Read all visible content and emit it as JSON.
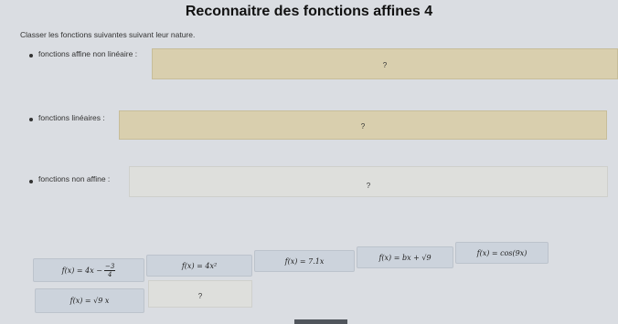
{
  "title": "Reconnaitre des fonctions affines 4",
  "instruction": "Classer les fonctions suivantes suivant leur nature.",
  "categories": [
    {
      "label": "fonctions affine non linéaire :",
      "drop_placeholder": "?"
    },
    {
      "label": "fonctions linéaires :",
      "drop_placeholder": "?"
    },
    {
      "label": "fonctions non affine :",
      "drop_placeholder": "?"
    }
  ],
  "cards": [
    {
      "prefix": "f(x) = 4x −",
      "frac_num": "−3",
      "frac_den": "4"
    },
    {
      "text": "f(x) = 4x²"
    },
    {
      "text": "f(x) = 7.1x"
    },
    {
      "text": "f(x) = bx + √9"
    },
    {
      "text": "f(x) = cos(9x)"
    },
    {
      "text": "f(x) = √9 x"
    }
  ],
  "pool_placeholder": "?"
}
